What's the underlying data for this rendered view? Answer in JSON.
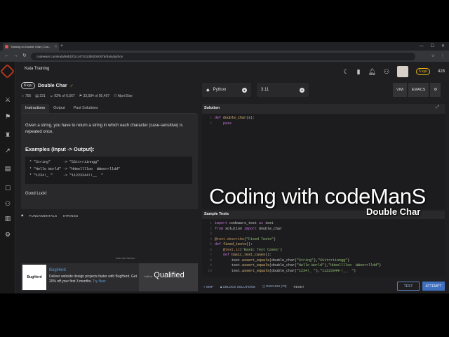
{
  "browser": {
    "tab_title": "Training on Double Char | Cod...",
    "url": "codewars.com/kata/56b1f01c247c01db92000076/train/python",
    "new_tab": "+",
    "tab_close": "×"
  },
  "topnav": {
    "section": "Kata Training",
    "rank": "5 kyu",
    "honor": "428"
  },
  "kata": {
    "rank": "8 kyu",
    "title": "Double Char",
    "stats": [
      "756",
      "231",
      "93% of 6,567",
      "33,584 of 95,497",
      "Alpri Else"
    ]
  },
  "panel_tabs": [
    "Instructions",
    "Output",
    "Past Solutions"
  ],
  "description": {
    "text": "Given a string, you have to return a string in which each character (case-sensitive) is repeated once.",
    "examples_heading": "Examples (Input -> Output):",
    "examples": [
      "* \"String\"      -> \"SSttrriinngg\"",
      "* \"Hello World\" -> \"HHeelllloo  WWoorrlldd\"",
      "* \"1234!_ \"     -> \"11223344!!__  \""
    ],
    "closing": "Good Luck!"
  },
  "tags": [
    "FUNDAMENTALS",
    "STRINGS"
  ],
  "ad": {
    "label": "Ads via Carbon",
    "logo": "BugHerd",
    "title": "BugHerd",
    "body": "Deliver website design projects faster with BugHerd. Get 20% off your first 3 months.",
    "cta": "Try Now",
    "sponsor_prefix": "built on",
    "sponsor": "Qualified"
  },
  "editor": {
    "language": "Python",
    "version": "3.11",
    "modes": [
      "VIM",
      "EMACS"
    ],
    "solution_label": "Solution",
    "tests_label": "Sample Tests"
  },
  "actions": {
    "skip": "SKIP",
    "unlock": "UNLOCK SOLUTIONS",
    "discuss": "DISCUSS (73)",
    "reset": "RESET",
    "test": "TEST",
    "attempt": "ATTEMPT"
  },
  "watermark": {
    "title": "Coding with codeManS",
    "subtitle": "Double Char"
  },
  "colors": {
    "brand": "#b1361e",
    "rank_yellow": "#ecb613",
    "attempt_blue": "#3f6fbf"
  }
}
